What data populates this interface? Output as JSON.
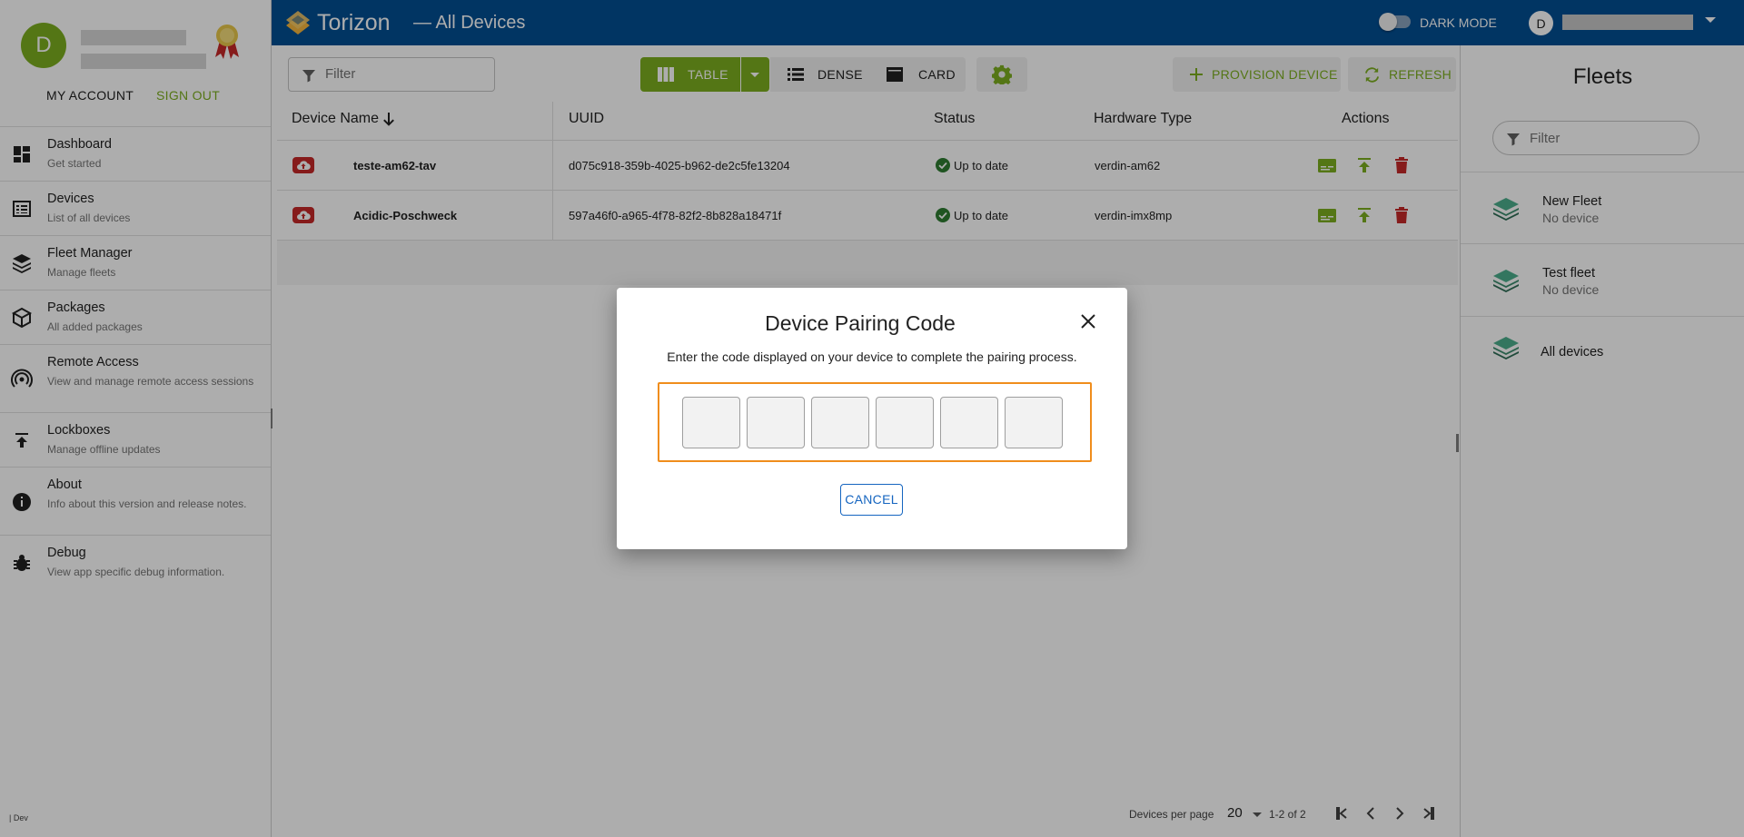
{
  "sidebar": {
    "avatar_initial": "D",
    "my_account": "MY ACCOUNT",
    "sign_out": "SIGN OUT",
    "items": [
      {
        "label": "Dashboard",
        "sub": "Get started"
      },
      {
        "label": "Devices",
        "sub": "List of all devices"
      },
      {
        "label": "Fleet Manager",
        "sub": "Manage fleets"
      },
      {
        "label": "Packages",
        "sub": "All added packages"
      },
      {
        "label": "Remote Access",
        "sub": "View and manage remote access sessions"
      },
      {
        "label": "Lockboxes",
        "sub": "Manage offline updates"
      },
      {
        "label": "About",
        "sub": "Info about this version and release notes."
      },
      {
        "label": "Debug",
        "sub": "View app specific debug information."
      }
    ],
    "env": "| Dev"
  },
  "topbar": {
    "brand": "Torizon",
    "title": "— All Devices",
    "dark_mode": "DARK MODE",
    "user_initial": "D"
  },
  "toolbar": {
    "filter_placeholder": "Filter",
    "view_table": "TABLE",
    "view_dense": "DENSE",
    "view_card": "CARD",
    "provision": "PROVISION DEVICE",
    "refresh": "REFRESH"
  },
  "table": {
    "headers": [
      "Device Name",
      "UUID",
      "Status",
      "Hardware Type",
      "Actions"
    ],
    "rows": [
      {
        "name": "teste-am62-tav",
        "uuid": "d075c918-359b-4025-b962-de2c5fe13204",
        "status": "Up to date",
        "hardware": "verdin-am62"
      },
      {
        "name": "Acidic-Poschweck",
        "uuid": "597a46f0-a965-4f78-82f2-8b828a18471f",
        "status": "Up to date",
        "hardware": "verdin-imx8mp"
      }
    ]
  },
  "pager": {
    "label": "Devices per page",
    "size": "20",
    "range": "1-2 of 2"
  },
  "fleets": {
    "title": "Fleets",
    "filter_placeholder": "Filter",
    "items": [
      {
        "name": "New Fleet",
        "sub": "No device"
      },
      {
        "name": "Test fleet",
        "sub": "No device"
      },
      {
        "name": "All devices",
        "sub": ""
      }
    ]
  },
  "modal": {
    "title": "Device Pairing Code",
    "description": "Enter the code displayed on your device to complete the pairing process.",
    "cancel": "CANCEL",
    "code_digits": [
      "",
      "",
      "",
      "",
      "",
      ""
    ]
  },
  "colors": {
    "brand_blue": "#024e93",
    "accent_green": "#7cae1f",
    "delete_red": "#c62828",
    "focus_orange": "#f08d1c",
    "link_blue": "#1565c0"
  }
}
